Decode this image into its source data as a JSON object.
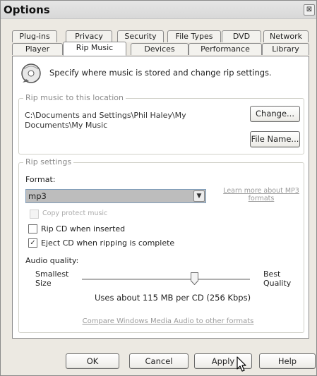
{
  "window": {
    "title": "Options",
    "close_glyph": "⊠"
  },
  "tabs_row1": [
    "Plug-ins",
    "Privacy",
    "Security",
    "File Types",
    "DVD",
    "Network"
  ],
  "tabs_row2": [
    "Player",
    "Rip Music",
    "Devices",
    "Performance",
    "Library"
  ],
  "active_tab": "Rip Music",
  "header": {
    "text": "Specify where music is stored and change rip settings.",
    "icon": "cd-icon"
  },
  "location": {
    "group_label": "Rip music to this location",
    "path": "C:\\Documents and Settings\\Phil Haley\\My Documents\\My Music",
    "change_button": "Change...",
    "filename_button": "File Name..."
  },
  "rip_settings": {
    "group_label": "Rip settings",
    "format_label": "Format:",
    "format_value": "mp3",
    "format_link": "Learn more about MP3 formats",
    "copy_protect_label": "Copy protect music",
    "copy_protect_checked": false,
    "rip_on_insert_label": "Rip CD when inserted",
    "rip_on_insert_checked": false,
    "eject_label": "Eject CD when ripping is complete",
    "eject_checked": true,
    "quality_label": "Audio quality:",
    "smallest_label": "Smallest",
    "size_label": "Size",
    "best_label": "Best",
    "quality_word": "Quality",
    "usage_text": "Uses about 115 MB per CD (256 Kbps)",
    "quality_level": 0.67,
    "compare_link": "Compare Windows Media Audio to other formats"
  },
  "buttons": {
    "ok": "OK",
    "cancel": "Cancel",
    "apply": "Apply",
    "help": "Help"
  },
  "colors": {
    "dialog_bg": "#ece9e2",
    "panel_bg": "#ffffff",
    "border": "#8a8a8a",
    "link": "#9a9a9a"
  }
}
